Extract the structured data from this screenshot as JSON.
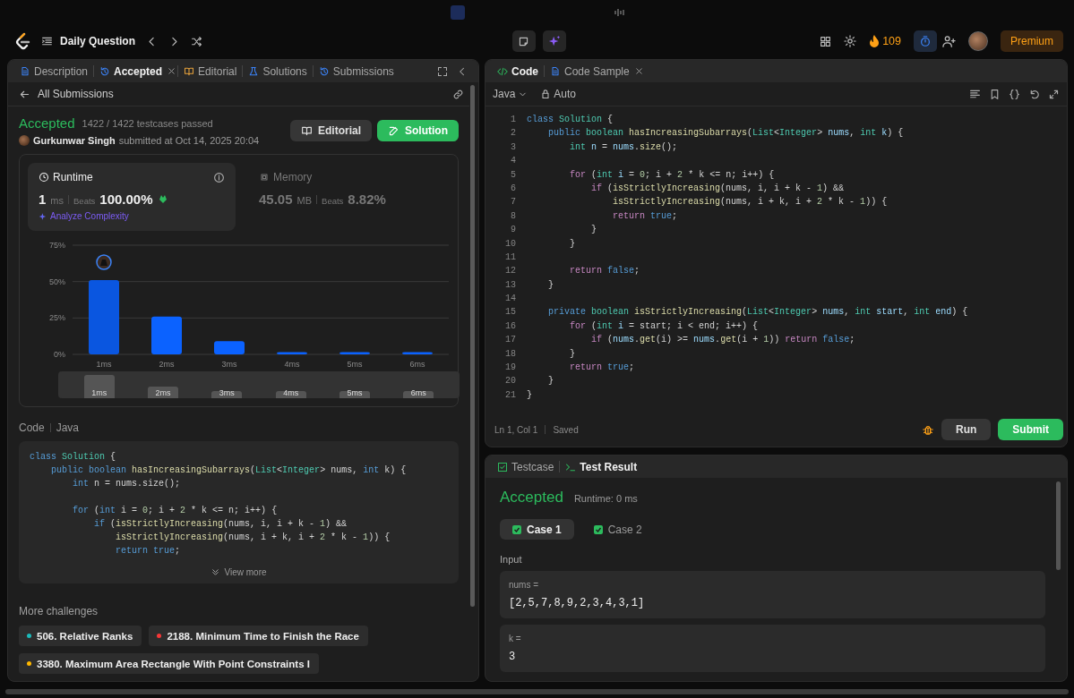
{
  "nav": {
    "title": "Daily Question",
    "streak": "109",
    "premium": "Premium"
  },
  "left_panel": {
    "tabs": [
      {
        "label": "Description",
        "selected": false,
        "closable": false
      },
      {
        "label": "Accepted",
        "selected": true,
        "closable": true
      },
      {
        "label": "Editorial",
        "selected": false,
        "closable": false
      },
      {
        "label": "Solutions",
        "selected": false,
        "closable": false
      },
      {
        "label": "Submissions",
        "selected": false,
        "closable": false
      }
    ],
    "back_link": "All Submissions",
    "submission": {
      "status": "Accepted",
      "testcases": "1422 / 1422 testcases passed",
      "author": "Gurkunwar Singh",
      "submitted": "submitted at Oct 14, 2025 20:04",
      "buttons": [
        {
          "label": "Editorial",
          "kind": "secondary"
        },
        {
          "label": "Solution",
          "kind": "primary"
        }
      ]
    },
    "stats": [
      {
        "kind": "runtime",
        "label": "Runtime",
        "value": "1",
        "unit": "ms",
        "beats_label": "Beats",
        "beats": "100.00%",
        "selected": true,
        "action": "Analyze Complexity"
      },
      {
        "kind": "memory",
        "label": "Memory",
        "value": "45.05",
        "unit": "MB",
        "beats_label": "Beats",
        "beats": "8.82%",
        "selected": false
      }
    ],
    "chart_data": {
      "type": "bar",
      "categories": [
        "1ms",
        "2ms",
        "3ms",
        "4ms",
        "5ms",
        "6ms"
      ],
      "values": [
        51,
        26,
        9,
        1.5,
        1.5,
        1.5
      ],
      "ylim": [
        0,
        75
      ],
      "yticks": [
        {
          "value": 0,
          "label": "0%"
        },
        {
          "value": 25,
          "label": "25%"
        },
        {
          "value": 50,
          "label": "50%"
        },
        {
          "value": 75,
          "label": "75%"
        }
      ]
    },
    "bars": [
      {
        "selected": true
      },
      {
        "selected": false
      },
      {
        "selected": false
      },
      {
        "selected": false
      },
      {
        "selected": false
      },
      {
        "selected": false
      }
    ],
    "range_labels": [
      "1ms",
      "2ms",
      "3ms",
      "4ms",
      "5ms",
      "6ms"
    ],
    "code_label": "Code",
    "code_language": "Java",
    "code_snippet": [
      {
        "tokens": [
          {
            "kind": "kw",
            "text": "class"
          },
          {
            "kind": "ty",
            "text": " Solution"
          },
          {
            "kind": "p",
            "text": " {"
          }
        ]
      },
      {
        "tokens": [
          {
            "kind": "kw",
            "text": "    public"
          },
          {
            "kind": "kw",
            "text": " boolean"
          },
          {
            "kind": "fn",
            "text": " hasIncreasingSubarrays"
          },
          {
            "kind": "p",
            "text": "("
          },
          {
            "kind": "ty",
            "text": "List"
          },
          {
            "kind": "p",
            "text": "<"
          },
          {
            "kind": "ty",
            "text": "Integer"
          },
          {
            "kind": "p",
            "text": "> nums,"
          },
          {
            "kind": "kw",
            "text": " int"
          },
          {
            "kind": "p",
            "text": " k) {"
          }
        ]
      },
      {
        "tokens": [
          {
            "kind": "kw",
            "text": "        int"
          },
          {
            "kind": "p",
            "text": " n = nums.size();"
          }
        ]
      },
      {
        "tokens": [
          {
            "kind": "kw",
            "text": "\n        for"
          },
          {
            "kind": "p",
            "text": " ("
          },
          {
            "kind": "kw",
            "text": "int"
          },
          {
            "kind": "p",
            "text": " i = "
          },
          {
            "kind": "n",
            "text": "0"
          },
          {
            "kind": "p",
            "text": "; i + "
          },
          {
            "kind": "n",
            "text": "2"
          },
          {
            "kind": "p",
            "text": " * k <= n; i++) {"
          }
        ]
      },
      {
        "tokens": [
          {
            "kind": "kw",
            "text": "            if"
          },
          {
            "kind": "p",
            "text": " ("
          },
          {
            "kind": "fn",
            "text": "isStrictlyIncreasing"
          },
          {
            "kind": "p",
            "text": "(nums, i, i + k - "
          },
          {
            "kind": "n",
            "text": "1"
          },
          {
            "kind": "p",
            "text": ") &&"
          }
        ]
      },
      {
        "tokens": [
          {
            "kind": "fn",
            "text": "                isStrictlyIncreasing"
          },
          {
            "kind": "p",
            "text": "(nums, i + k, i + "
          },
          {
            "kind": "n",
            "text": "2"
          },
          {
            "kind": "p",
            "text": " * k - "
          },
          {
            "kind": "n",
            "text": "1"
          },
          {
            "kind": "p",
            "text": ")) {"
          }
        ]
      },
      {
        "tokens": [
          {
            "kind": "kw",
            "text": "                return"
          },
          {
            "kind": "kw",
            "text": " true"
          },
          {
            "kind": "p",
            "text": ";"
          }
        ]
      }
    ],
    "view_more": "View more",
    "more_title": "More challenges",
    "challenges": [
      {
        "title": "506. Relative Ranks",
        "color": "#1cbaba"
      },
      {
        "title": "2188. Minimum Time to Finish the Race",
        "color": "#f63737"
      },
      {
        "title": "3380. Maximum Area Rectangle With Point Constraints I",
        "color": "#ffb800"
      }
    ]
  },
  "editor": {
    "tabs": [
      {
        "label": "Code",
        "selected": true,
        "closable": false
      },
      {
        "label": "Code Sample",
        "selected": false,
        "closable": true
      }
    ],
    "language": "Java",
    "mode": "Auto",
    "lines": [
      {
        "n": "1",
        "tokens": [
          {
            "kind": "kw",
            "text": "class"
          },
          {
            "kind": "ty",
            "text": " Solution"
          },
          {
            "kind": "p",
            "text": " {"
          }
        ]
      },
      {
        "n": "2",
        "tokens": [
          {
            "kind": "kw",
            "text": "    public"
          },
          {
            "kind": "ty",
            "text": " boolean"
          },
          {
            "kind": "fn",
            "text": " hasIncreasingSubarrays"
          },
          {
            "kind": "p",
            "text": "("
          },
          {
            "kind": "ty",
            "text": "List"
          },
          {
            "kind": "p",
            "text": "<"
          },
          {
            "kind": "ty",
            "text": "Integer"
          },
          {
            "kind": "p",
            "text": ">"
          },
          {
            "kind": "v",
            "text": " nums"
          },
          {
            "kind": "p",
            "text": ","
          },
          {
            "kind": "ty",
            "text": " int"
          },
          {
            "kind": "v",
            "text": " k"
          },
          {
            "kind": "p",
            "text": ") {"
          }
        ]
      },
      {
        "n": "3",
        "tokens": [
          {
            "kind": "ty",
            "text": "        int"
          },
          {
            "kind": "v",
            "text": " n"
          },
          {
            "kind": "p",
            "text": " = "
          },
          {
            "kind": "v",
            "text": "nums"
          },
          {
            "kind": "p",
            "text": "."
          },
          {
            "kind": "fn",
            "text": "size"
          },
          {
            "kind": "p",
            "text": "();"
          }
        ]
      },
      {
        "n": "4"
      },
      {
        "n": "5",
        "tokens": [
          {
            "kind": "ctl",
            "text": "        for"
          },
          {
            "kind": "p",
            "text": " ("
          },
          {
            "kind": "ty",
            "text": "int"
          },
          {
            "kind": "v",
            "text": " i"
          },
          {
            "kind": "p",
            "text": " = "
          },
          {
            "kind": "n",
            "text": "0"
          },
          {
            "kind": "p",
            "text": "; i + "
          },
          {
            "kind": "n",
            "text": "2"
          },
          {
            "kind": "p",
            "text": " * k <= n; i++) {"
          }
        ]
      },
      {
        "n": "6",
        "tokens": [
          {
            "kind": "ctl",
            "text": "            if"
          },
          {
            "kind": "p",
            "text": " ("
          },
          {
            "kind": "fn",
            "text": "isStrictlyIncreasing"
          },
          {
            "kind": "p",
            "text": "(nums, i, i + k - "
          },
          {
            "kind": "n",
            "text": "1"
          },
          {
            "kind": "p",
            "text": ") &&"
          }
        ]
      },
      {
        "n": "7",
        "tokens": [
          {
            "kind": "fn",
            "text": "                isStrictlyIncreasing"
          },
          {
            "kind": "p",
            "text": "(nums, i + k, i + "
          },
          {
            "kind": "n",
            "text": "2"
          },
          {
            "kind": "p",
            "text": " * k - "
          },
          {
            "kind": "n",
            "text": "1"
          },
          {
            "kind": "p",
            "text": ")) {"
          }
        ]
      },
      {
        "n": "8",
        "tokens": [
          {
            "kind": "ctl",
            "text": "                return"
          },
          {
            "kind": "kw",
            "text": " true"
          },
          {
            "kind": "p",
            "text": ";"
          }
        ]
      },
      {
        "n": "9",
        "tokens": [
          {
            "kind": "p",
            "text": "            }"
          }
        ]
      },
      {
        "n": "10",
        "tokens": [
          {
            "kind": "p",
            "text": "        }"
          }
        ]
      },
      {
        "n": "11"
      },
      {
        "n": "12",
        "tokens": [
          {
            "kind": "ctl",
            "text": "        return"
          },
          {
            "kind": "kw",
            "text": " false"
          },
          {
            "kind": "p",
            "text": ";"
          }
        ]
      },
      {
        "n": "13",
        "tokens": [
          {
            "kind": "p",
            "text": "    }"
          }
        ]
      },
      {
        "n": "14"
      },
      {
        "n": "15",
        "tokens": [
          {
            "kind": "kw",
            "text": "    private"
          },
          {
            "kind": "ty",
            "text": " boolean"
          },
          {
            "kind": "fn",
            "text": " isStrictlyIncreasing"
          },
          {
            "kind": "p",
            "text": "("
          },
          {
            "kind": "ty",
            "text": "List"
          },
          {
            "kind": "p",
            "text": "<"
          },
          {
            "kind": "ty",
            "text": "Integer"
          },
          {
            "kind": "p",
            "text": ">"
          },
          {
            "kind": "v",
            "text": " nums"
          },
          {
            "kind": "p",
            "text": ","
          },
          {
            "kind": "ty",
            "text": " int"
          },
          {
            "kind": "v",
            "text": " start"
          },
          {
            "kind": "p",
            "text": ","
          },
          {
            "kind": "ty",
            "text": " int"
          },
          {
            "kind": "v",
            "text": " end"
          },
          {
            "kind": "p",
            "text": ") {"
          }
        ]
      },
      {
        "n": "16",
        "tokens": [
          {
            "kind": "ctl",
            "text": "        for"
          },
          {
            "kind": "p",
            "text": " ("
          },
          {
            "kind": "ty",
            "text": "int"
          },
          {
            "kind": "v",
            "text": " i"
          },
          {
            "kind": "p",
            "text": " = start; i < end; i++) {"
          }
        ]
      },
      {
        "n": "17",
        "tokens": [
          {
            "kind": "ctl",
            "text": "            if"
          },
          {
            "kind": "p",
            "text": " ("
          },
          {
            "kind": "v",
            "text": "nums"
          },
          {
            "kind": "p",
            "text": "."
          },
          {
            "kind": "fn",
            "text": "get"
          },
          {
            "kind": "p",
            "text": "(i) >= "
          },
          {
            "kind": "v",
            "text": "nums"
          },
          {
            "kind": "p",
            "text": "."
          },
          {
            "kind": "fn",
            "text": "get"
          },
          {
            "kind": "p",
            "text": "(i + "
          },
          {
            "kind": "n",
            "text": "1"
          },
          {
            "kind": "p",
            "text": "))"
          },
          {
            "kind": "ctl",
            "text": " return"
          },
          {
            "kind": "kw",
            "text": " false"
          },
          {
            "kind": "p",
            "text": ";"
          }
        ]
      },
      {
        "n": "18",
        "tokens": [
          {
            "kind": "p",
            "text": "        }"
          }
        ]
      },
      {
        "n": "19",
        "tokens": [
          {
            "kind": "ctl",
            "text": "        return"
          },
          {
            "kind": "kw",
            "text": " true"
          },
          {
            "kind": "p",
            "text": ";"
          }
        ]
      },
      {
        "n": "20",
        "tokens": [
          {
            "kind": "p",
            "text": "    }"
          }
        ]
      },
      {
        "n": "21",
        "tokens": [
          {
            "kind": "p",
            "text": "}"
          }
        ]
      }
    ],
    "cursor": "Ln 1, Col 1",
    "save_state": "Saved",
    "buttons": [
      {
        "label": "Run",
        "kind": "secondary"
      },
      {
        "label": "Submit",
        "kind": "primary"
      }
    ]
  },
  "result": {
    "tabs": [
      {
        "label": "Testcase",
        "selected": false
      },
      {
        "label": "Test Result",
        "selected": true
      }
    ],
    "status": "Accepted",
    "runtime": "Runtime: 0 ms",
    "cases": [
      {
        "label": "Case 1",
        "selected": true,
        "passed": true
      },
      {
        "label": "Case 2",
        "selected": false,
        "passed": true
      }
    ],
    "input_label": "Input",
    "inputs": [
      {
        "name": "nums =",
        "value": "[2,5,7,8,9,2,3,4,3,1]"
      },
      {
        "name": "k =",
        "value": "3"
      }
    ]
  }
}
